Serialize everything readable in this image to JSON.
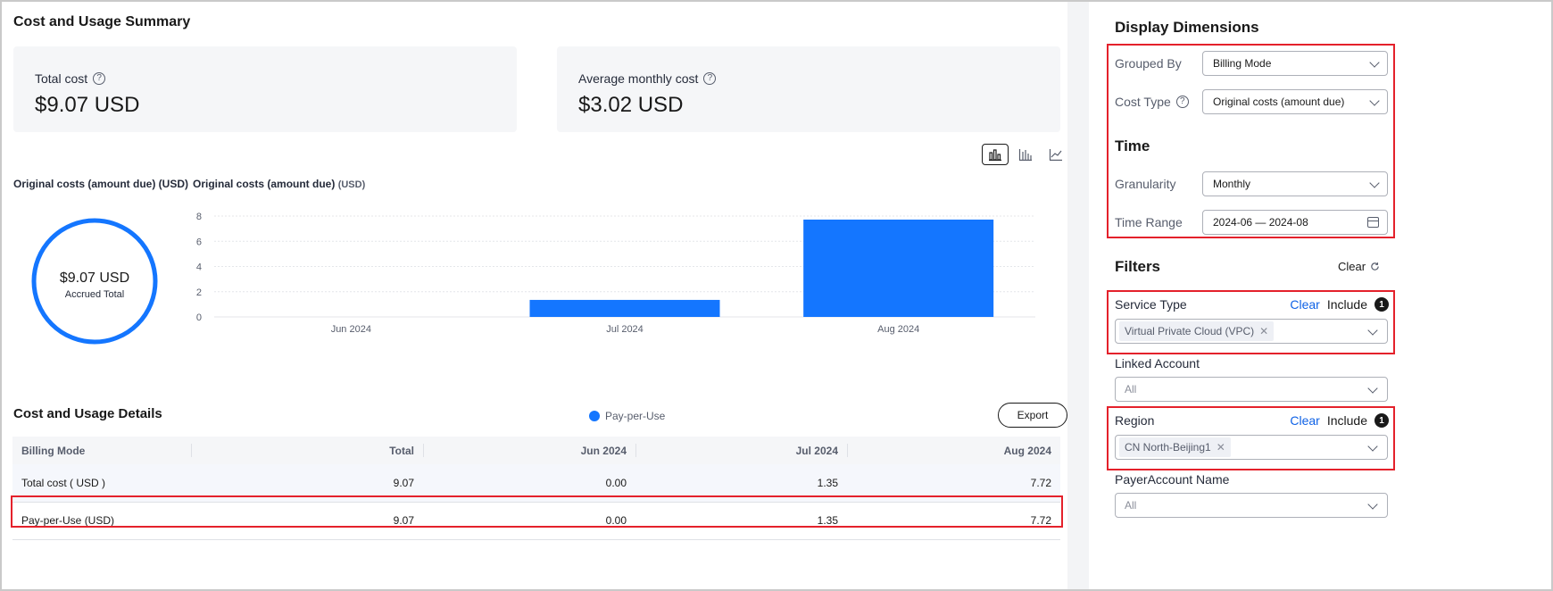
{
  "summary": {
    "title": "Cost and Usage Summary",
    "total_cost_label": "Total cost",
    "total_cost_value": "$9.07 USD",
    "avg_cost_label": "Average monthly cost",
    "avg_cost_value": "$3.02 USD"
  },
  "donut": {
    "title": "Original costs (amount due) (USD)",
    "value": "$9.07 USD",
    "caption": "Accrued Total",
    "color": "#1476ff"
  },
  "chart_view_icons": [
    "bar-chart-icon",
    "stacked-bar-chart-icon",
    "line-chart-icon"
  ],
  "chart_data": {
    "type": "bar",
    "title": "Original costs (amount due)",
    "title_unit": "(USD)",
    "categories": [
      "Jun 2024",
      "Jul 2024",
      "Aug 2024"
    ],
    "series": [
      {
        "name": "Pay-per-Use",
        "values": [
          0.0,
          1.35,
          7.72
        ],
        "color": "#1476ff"
      }
    ],
    "yticks": [
      "8",
      "6",
      "4",
      "2",
      "0"
    ],
    "ylim": [
      0,
      8
    ],
    "grid": true,
    "legend_position": "bottom"
  },
  "details": {
    "title": "Cost and Usage Details",
    "export_label": "Export",
    "columns": [
      "Billing Mode",
      "Total",
      "Jun 2024",
      "Jul 2024",
      "Aug 2024"
    ],
    "rows": [
      [
        "Total cost ( USD )",
        "9.07",
        "0.00",
        "1.35",
        "7.72"
      ],
      [
        "Pay-per-Use (USD)",
        "9.07",
        "0.00",
        "1.35",
        "7.72"
      ]
    ]
  },
  "display": {
    "title": "Display Dimensions",
    "grouped_by_label": "Grouped By",
    "grouped_by_value": "Billing Mode",
    "cost_type_label": "Cost Type",
    "cost_type_value": "Original costs (amount due)"
  },
  "time": {
    "title": "Time",
    "granularity_label": "Granularity",
    "granularity_value": "Monthly",
    "range_label": "Time Range",
    "range_value": "2024-06 — 2024-08"
  },
  "filters": {
    "title": "Filters",
    "clear_all": "Clear",
    "service_type": {
      "label": "Service Type",
      "clear": "Clear",
      "include": "Include",
      "count": "1",
      "tag": "Virtual Private Cloud (VPC)"
    },
    "linked_account": {
      "label": "Linked Account",
      "value": "All"
    },
    "region": {
      "label": "Region",
      "clear": "Clear",
      "include": "Include",
      "count": "1",
      "tag": "CN North-Beijing1"
    },
    "payer_account": {
      "label": "PayerAccount Name",
      "value": "All"
    }
  },
  "highlight_color": "#e4212b"
}
